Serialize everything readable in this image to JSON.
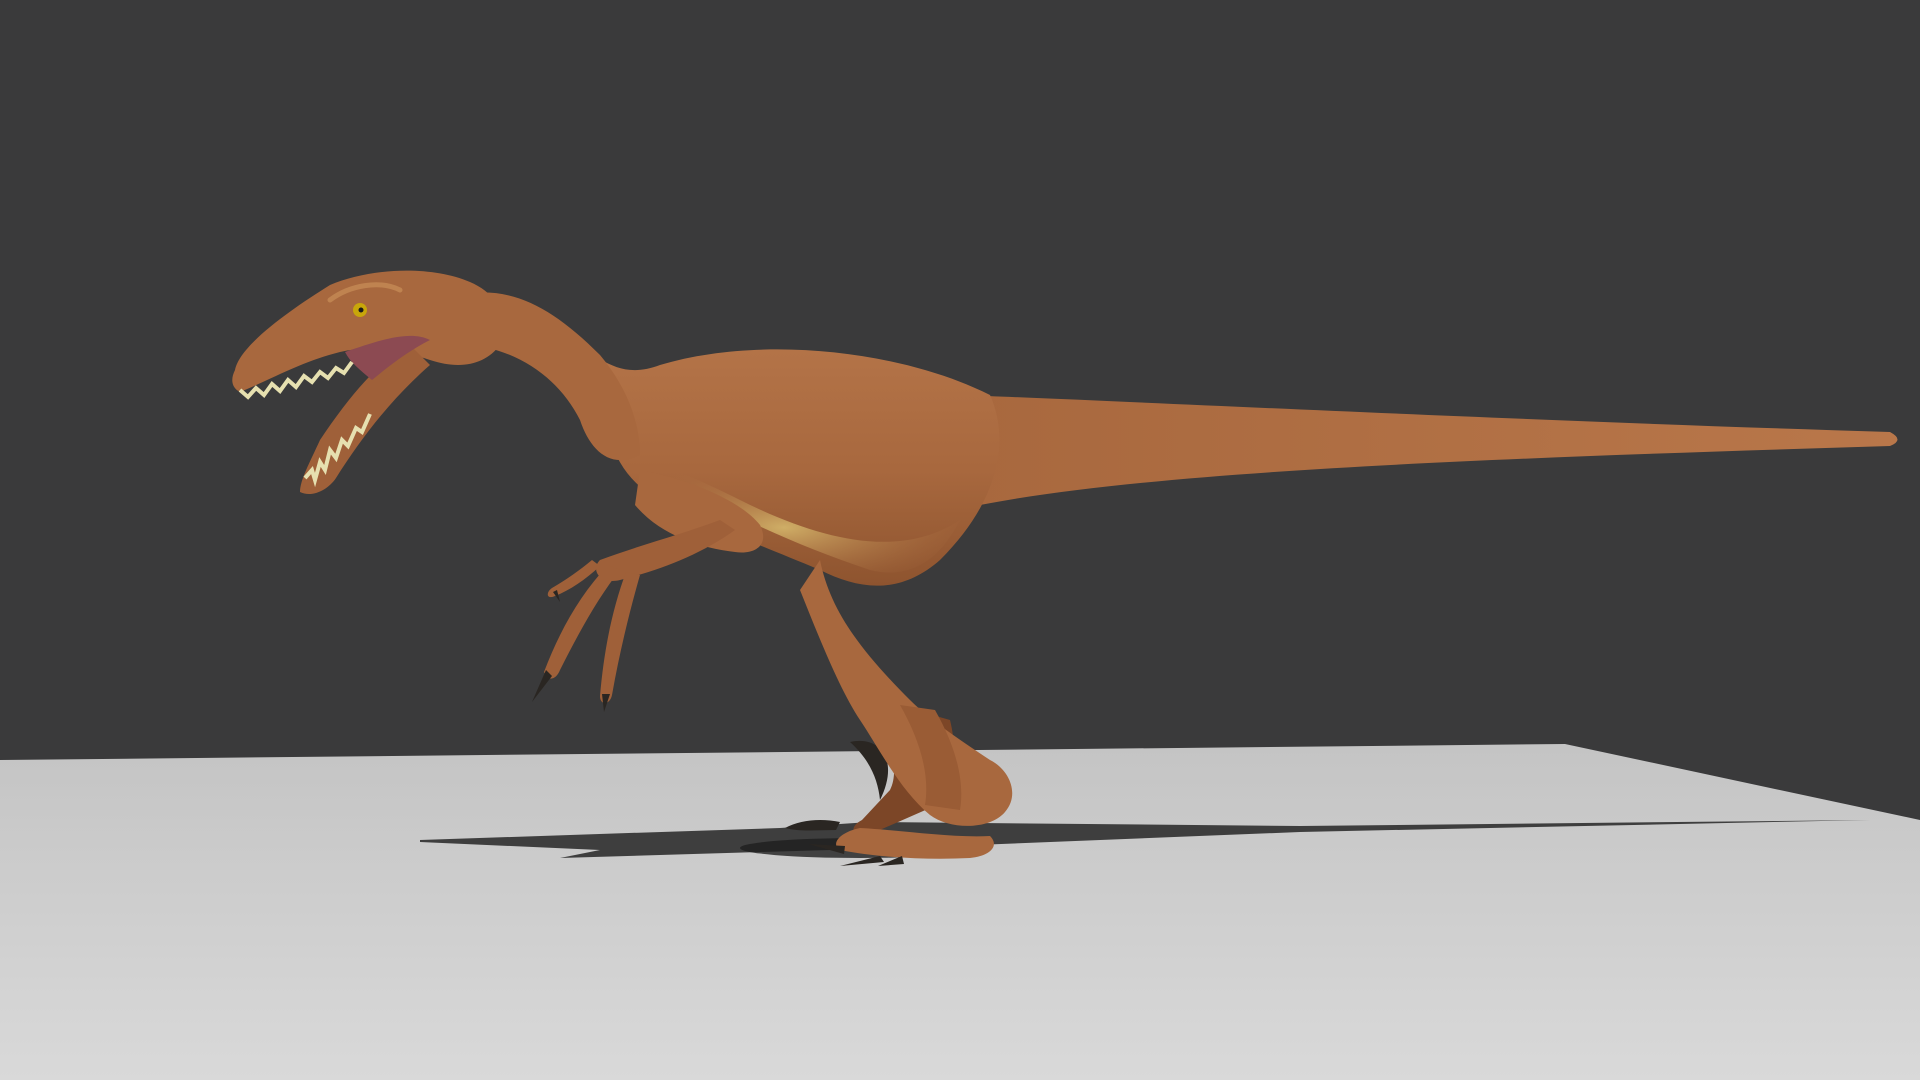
{
  "scene": {
    "subject": "raptor-dinosaur",
    "colors": {
      "background": "#3a3a3b",
      "floor": "#d7d7d7",
      "floor_far": "#bdbdbd",
      "shadow": "#262626",
      "skin": "#a8683e",
      "skin_light": "#c98f58",
      "belly": "#c9a25e",
      "skin_dark": "#7c4627",
      "claw": "#2a2622",
      "eye": "#c8a60a",
      "mouth": "#8c4a52",
      "teeth": "#e6e0b0"
    }
  }
}
